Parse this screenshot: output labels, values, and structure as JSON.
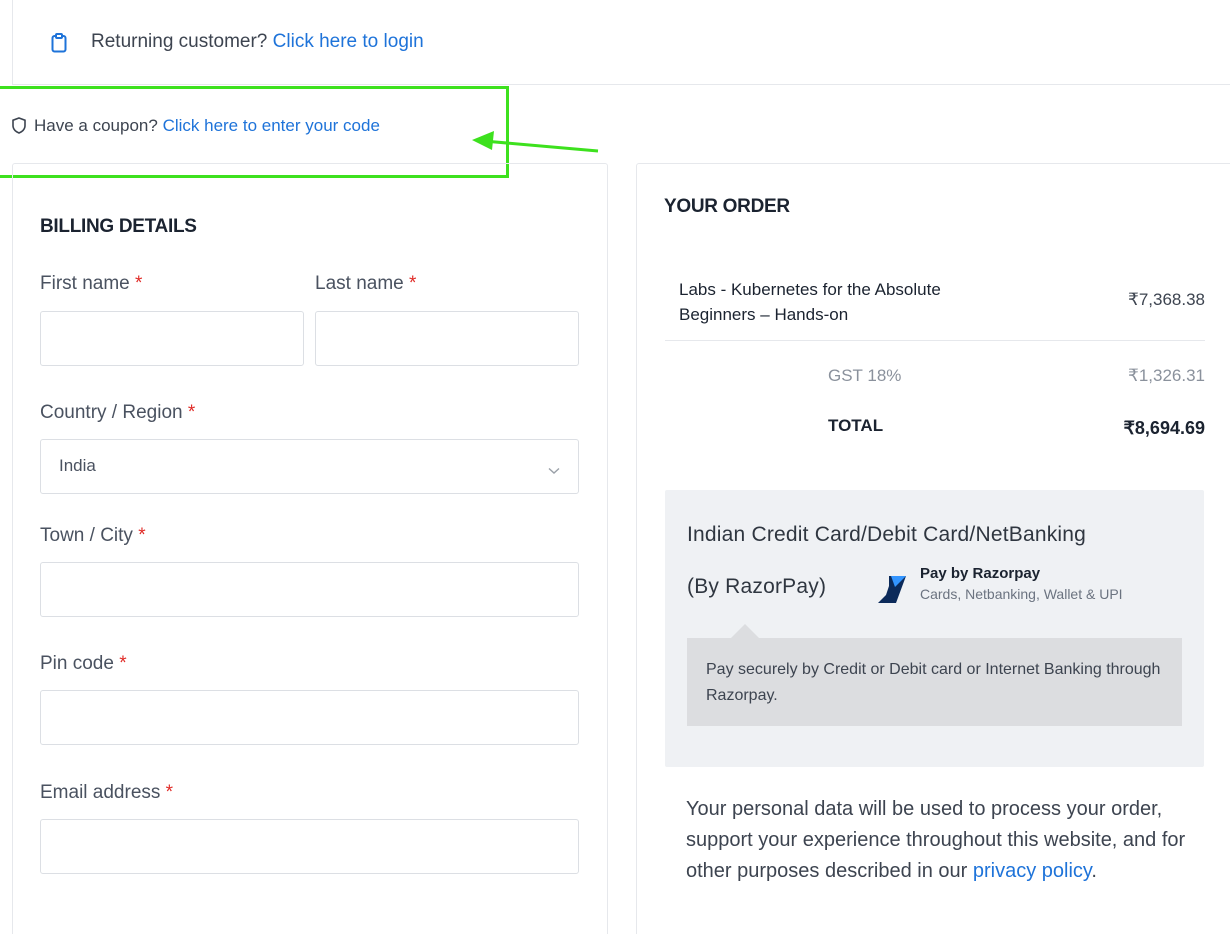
{
  "login_notice": {
    "text": "Returning customer?",
    "link": "Click here to login"
  },
  "coupon_notice": {
    "text": "Have a coupon?",
    "link": "Click here to enter your code"
  },
  "billing": {
    "heading": "BILLING DETAILS",
    "first_name_label": "First name",
    "last_name_label": "Last name",
    "country_label": "Country / Region",
    "country_value": "India",
    "city_label": "Town / City",
    "pin_label": "Pin code",
    "email_label": "Email address",
    "required_mark": "*"
  },
  "order": {
    "heading": "YOUR ORDER",
    "item_name": "Labs - Kubernetes for the Absolute Beginners – Hands-on",
    "item_price": "₹7,368.38",
    "gst_label": "GST 18%",
    "gst_value": "₹1,326.31",
    "total_label": "TOTAL",
    "total_value": "₹8,694.69"
  },
  "payment": {
    "title": "Indian Credit Card/Debit Card/NetBanking",
    "by": "(By RazorPay)",
    "logo_title": "Pay by Razorpay",
    "logo_subtitle": "Cards, Netbanking, Wallet & UPI",
    "description": "Pay securely by Credit or Debit card or Internet Banking through Razorpay."
  },
  "privacy": {
    "text": "Your personal data will be used to process your order, support your experience throughout this website, and for other purposes described in our",
    "link": "privacy policy",
    "end": "."
  },
  "colors": {
    "link": "#1e73d9",
    "highlight": "#3de11e",
    "required": "#e02b27"
  }
}
